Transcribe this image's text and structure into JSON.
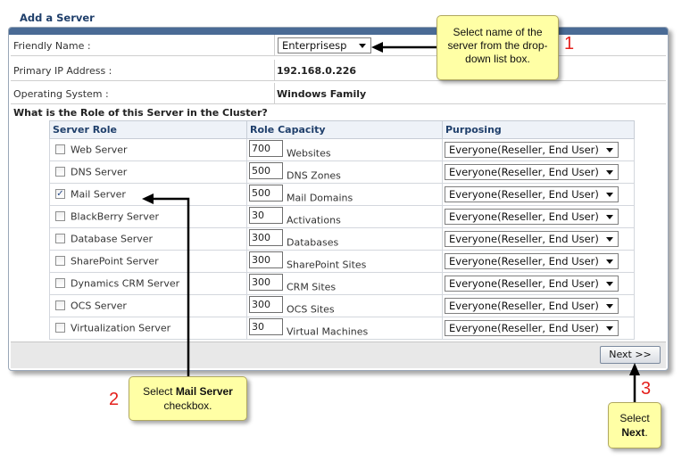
{
  "title": "Add a Server",
  "fields": {
    "friendly_name": {
      "label": "Friendly Name :",
      "value": "Enterprisesp"
    },
    "primary_ip": {
      "label": "Primary IP Address :",
      "value": "192.168.0.226"
    },
    "os": {
      "label": "Operating System :",
      "value": "Windows Family"
    }
  },
  "role_question": "What is the Role of this Server in the Cluster?",
  "table": {
    "headers": [
      "Server Role",
      "Role Capacity",
      "Purposing"
    ],
    "rows": [
      {
        "role": "Web Server",
        "checked": false,
        "capacity": "700",
        "unit": "Websites",
        "purposing": "Everyone(Reseller, End User)"
      },
      {
        "role": "DNS Server",
        "checked": false,
        "capacity": "500",
        "unit": "DNS Zones",
        "purposing": "Everyone(Reseller, End User)"
      },
      {
        "role": "Mail Server",
        "checked": true,
        "capacity": "500",
        "unit": "Mail Domains",
        "purposing": "Everyone(Reseller, End User)"
      },
      {
        "role": "BlackBerry Server",
        "checked": false,
        "capacity": "30",
        "unit": "Activations",
        "purposing": "Everyone(Reseller, End User)"
      },
      {
        "role": "Database Server",
        "checked": false,
        "capacity": "300",
        "unit": "Databases",
        "purposing": "Everyone(Reseller, End User)"
      },
      {
        "role": "SharePoint Server",
        "checked": false,
        "capacity": "300",
        "unit": "SharePoint Sites",
        "purposing": "Everyone(Reseller, End User)"
      },
      {
        "role": "Dynamics CRM Server",
        "checked": false,
        "capacity": "300",
        "unit": "CRM Sites",
        "purposing": "Everyone(Reseller, End User)"
      },
      {
        "role": "OCS Server",
        "checked": false,
        "capacity": "300",
        "unit": "OCS Sites",
        "purposing": "Everyone(Reseller, End User)"
      },
      {
        "role": "Virtualization Server",
        "checked": false,
        "capacity": "30",
        "unit": "Virtual Machines",
        "purposing": "Everyone(Reseller, End User)"
      }
    ]
  },
  "next_label": "Next >>",
  "callouts": {
    "one": {
      "number": "1",
      "text": "Select name of the server from the drop-down list box."
    },
    "two": {
      "number": "2",
      "text_pre": "Select ",
      "text_bold": "Mail Server",
      "text_post": " checkbox."
    },
    "three": {
      "number": "3",
      "text_pre": "Select ",
      "text_bold": "Next",
      "text_post": "."
    }
  },
  "colors": {
    "callout_bg": "#ffffa5",
    "step_number": "#e4201c",
    "header_text": "#1f3f6b",
    "title_bar": "#4a6b95"
  },
  "icons": {
    "dropdown": "chevron-down-icon",
    "arrow": "arrow-icon"
  }
}
